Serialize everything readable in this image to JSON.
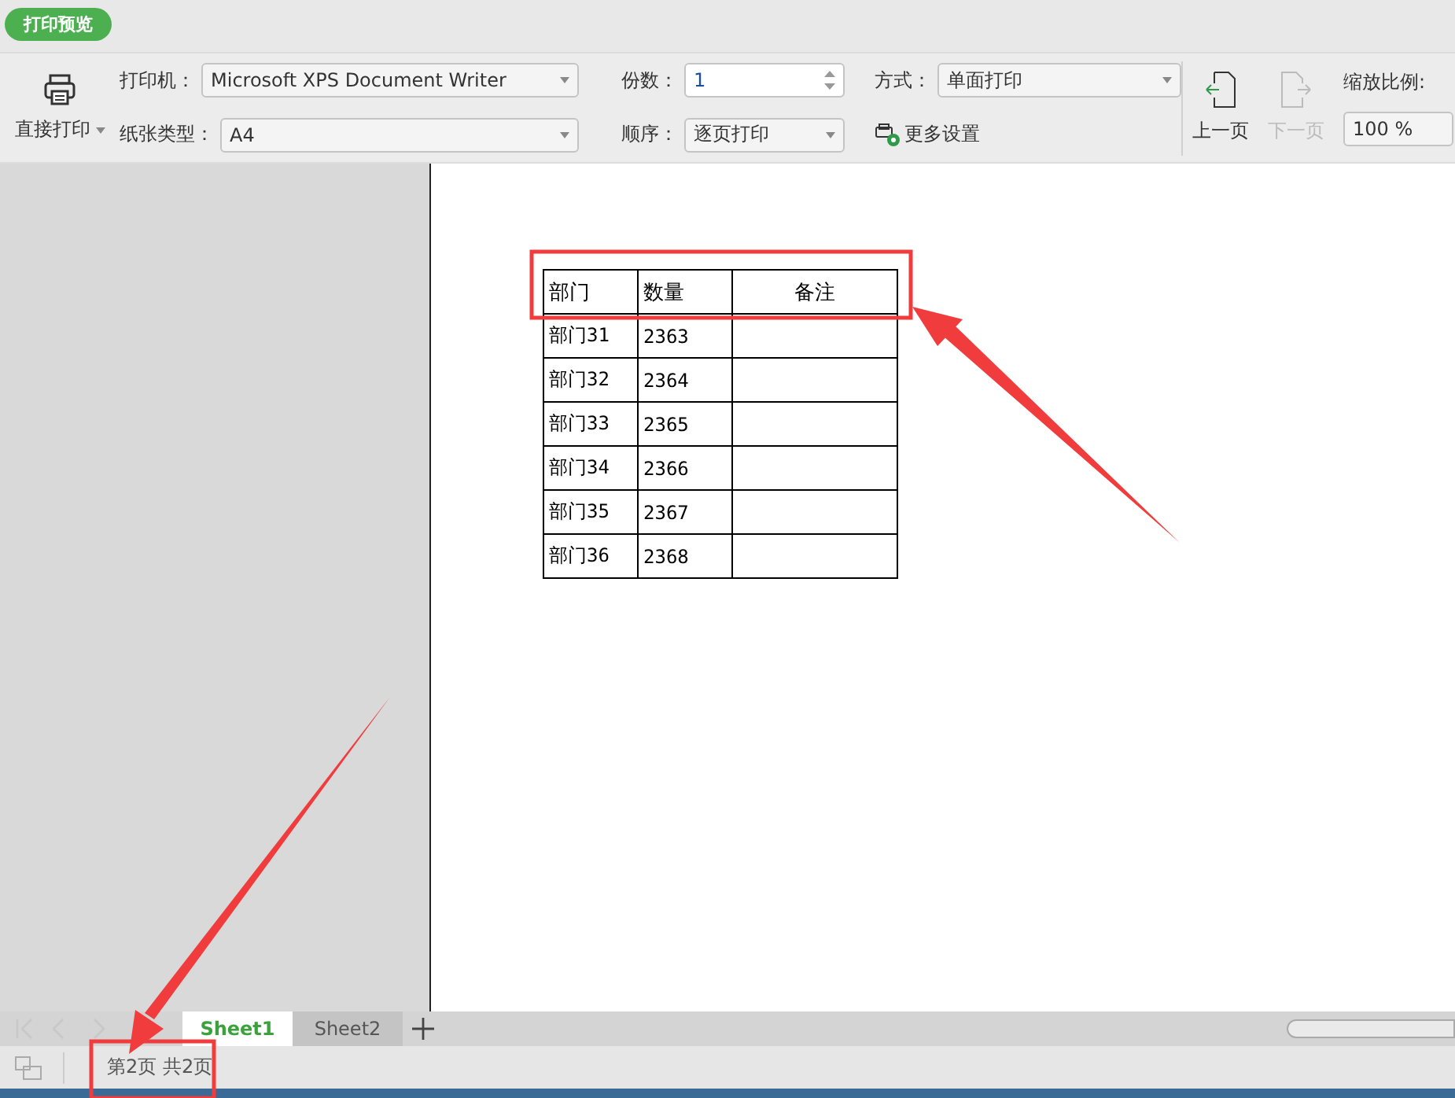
{
  "header": {
    "title": "打印预览"
  },
  "toolbar": {
    "print_button": {
      "label": "直接打印"
    },
    "printer": {
      "label": "打印机：",
      "value": "Microsoft XPS Document Writer"
    },
    "paper": {
      "label": "纸张类型：",
      "value": "A4"
    },
    "copies": {
      "label": "份数：",
      "value": "1"
    },
    "order": {
      "label": "顺序：",
      "value": "逐页打印"
    },
    "mode": {
      "label": "方式：",
      "value": "单面打印"
    },
    "more_settings": {
      "label": "更多设置"
    },
    "prev_page": {
      "label": "上一页",
      "disabled": false
    },
    "next_page": {
      "label": "下一页",
      "disabled": true
    },
    "zoom": {
      "label": "缩放比例:",
      "value": "100 %"
    }
  },
  "table": {
    "columns": [
      "部门",
      "数量",
      "备注"
    ],
    "rows": [
      [
        "部门31",
        "2363",
        ""
      ],
      [
        "部门32",
        "2364",
        ""
      ],
      [
        "部门33",
        "2365",
        ""
      ],
      [
        "部门34",
        "2366",
        ""
      ],
      [
        "部门35",
        "2367",
        ""
      ],
      [
        "部门36",
        "2368",
        ""
      ]
    ]
  },
  "sheet_tabs": [
    {
      "label": "Sheet1",
      "selected": true
    },
    {
      "label": "Sheet2",
      "selected": false
    }
  ],
  "status_bar": {
    "page_info": "第2页 共2页"
  }
}
